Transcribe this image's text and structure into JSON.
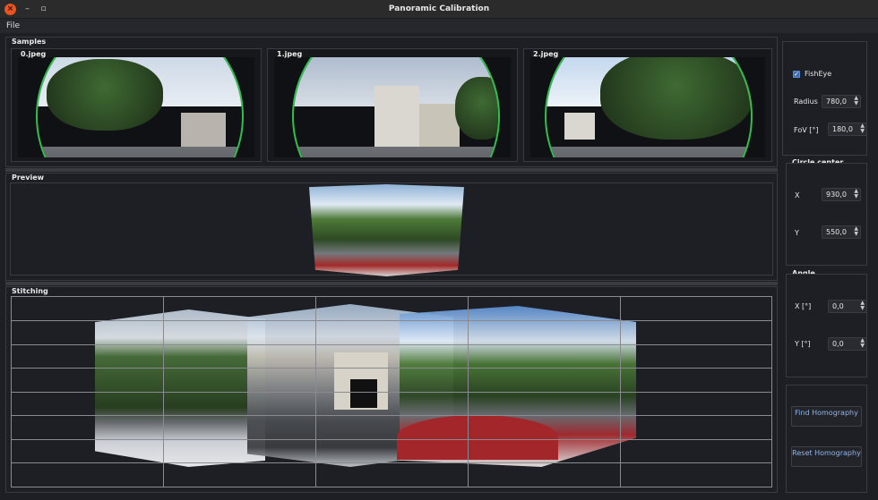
{
  "window": {
    "title": "Panoramic Calibration",
    "close": "×",
    "minimize": "–",
    "maximize": "▫"
  },
  "menu": {
    "file": "File"
  },
  "samples": {
    "title": "Samples",
    "items": [
      {
        "label": "0.jpeg"
      },
      {
        "label": "1.jpeg"
      },
      {
        "label": "2.jpeg"
      }
    ]
  },
  "preview": {
    "title": "Preview"
  },
  "stitching": {
    "title": "Stitching"
  },
  "fisheye": {
    "checkbox_label": "FishEye",
    "checked": true,
    "radius_label": "Radius",
    "radius_value": "780,0",
    "fov_label": "FoV [°]",
    "fov_value": "180,0"
  },
  "circle_center": {
    "title": "Circle center",
    "x_label": "X",
    "x_value": "930,0",
    "y_label": "Y",
    "y_value": "550,0"
  },
  "angle": {
    "title": "Angle",
    "x_label": "X [°]",
    "x_value": "0,0",
    "y_label": "Y [°]",
    "y_value": "0,0"
  },
  "actions": {
    "find_homography": "Find Homography",
    "reset_homography": "Reset Homography"
  },
  "colors": {
    "accent": "#8fb5e8",
    "fisheye_circle": "#2fbf4f",
    "close_button": "#e95420"
  }
}
